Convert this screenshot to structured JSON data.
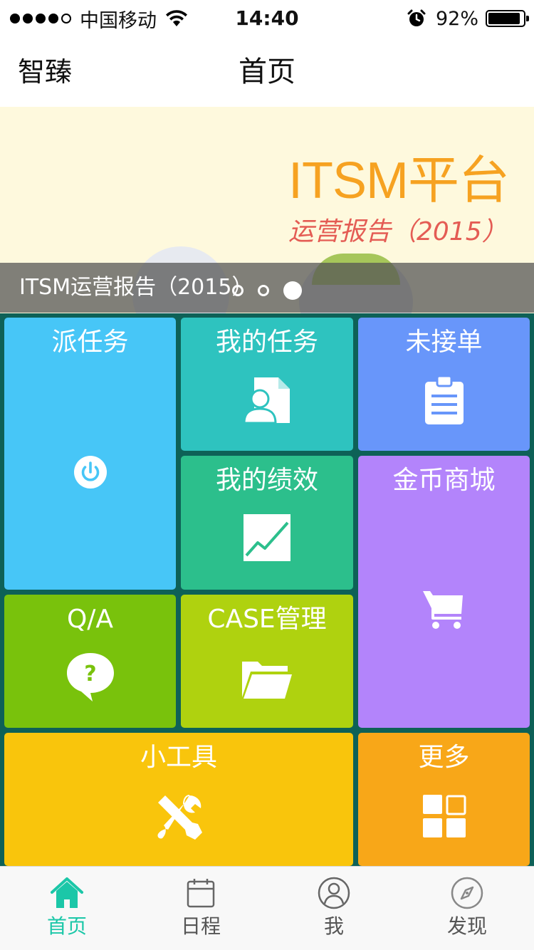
{
  "status_bar": {
    "carrier": "中国移动",
    "time": "14:40",
    "battery_percent": "92%",
    "battery_level": 0.92,
    "signal_bars": 4
  },
  "nav": {
    "left": "智臻",
    "title": "首页"
  },
  "banner": {
    "title": "ITSM平台",
    "subtitle": "运营报告（2015）",
    "caption": "ITSM运营报告（2015）",
    "pages": 3,
    "active_page": 3
  },
  "tiles": [
    {
      "label": "派任务",
      "color": "#47c6f7",
      "icon": "power-icon"
    },
    {
      "label": "我的任务",
      "color": "#2ec3bf",
      "icon": "person-document-icon"
    },
    {
      "label": "未接单",
      "color": "#6896fa",
      "icon": "clipboard-icon"
    },
    {
      "label": "我的绩效",
      "color": "#2cbf8c",
      "icon": "line-chart-icon"
    },
    {
      "label": "金币商城",
      "color": "#b384fb",
      "icon": "shopping-cart-icon"
    },
    {
      "label": "Q/A",
      "color": "#79c20c",
      "icon": "question-bubble-icon"
    },
    {
      "label": "CASE管理",
      "color": "#afd20f",
      "icon": "folder-icon"
    },
    {
      "label": "小工具",
      "color": "#f9c50c",
      "icon": "tools-icon"
    },
    {
      "label": "更多",
      "color": "#f8a718",
      "icon": "grid-icon"
    }
  ],
  "tabbar": {
    "active_color": "#1bc7a8",
    "items": [
      {
        "label": "首页",
        "icon": "home-icon"
      },
      {
        "label": "日程",
        "icon": "calendar-icon"
      },
      {
        "label": "我",
        "icon": "user-icon"
      },
      {
        "label": "发现",
        "icon": "compass-icon"
      }
    ]
  }
}
